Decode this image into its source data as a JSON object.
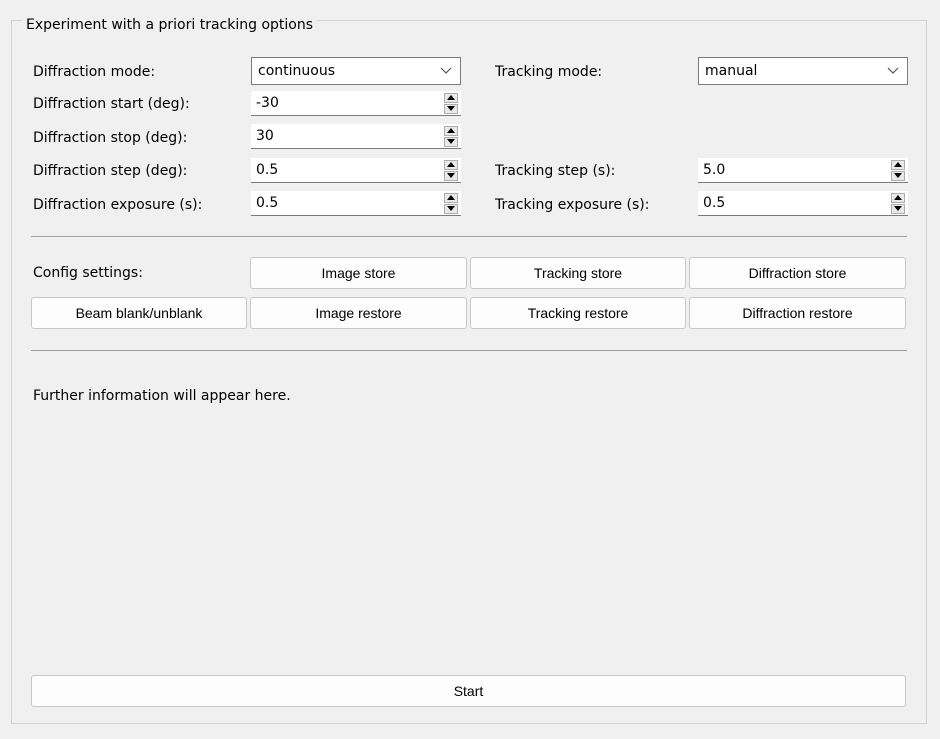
{
  "group": {
    "title": "Experiment with a priori tracking options"
  },
  "diffraction": {
    "mode_label": "Diffraction mode:",
    "mode_value": "continuous",
    "start_label": "Diffraction start (deg):",
    "start_value": "-30",
    "stop_label": "Diffraction stop (deg):",
    "stop_value": "30",
    "step_label": "Diffraction step (deg):",
    "step_value": "0.5",
    "exposure_label": "Diffraction exposure (s):",
    "exposure_value": "0.5"
  },
  "tracking": {
    "mode_label": "Tracking mode:",
    "mode_value": "manual",
    "step_label": "Tracking step (s):",
    "step_value": "5.0",
    "exposure_label": "Tracking exposure (s):",
    "exposure_value": "0.5"
  },
  "config": {
    "label": "Config settings:",
    "image_store": "Image store",
    "tracking_store": "Tracking store",
    "diffraction_store": "Diffraction store",
    "beam_blank": "Beam blank/unblank",
    "image_restore": "Image restore",
    "tracking_restore": "Tracking restore",
    "diffraction_restore": "Diffraction restore"
  },
  "info": {
    "message": "Further information will appear here."
  },
  "actions": {
    "start_label": "Start"
  },
  "icons": {
    "dropdown": "chevron-down-icon",
    "spin_up": "spin-up-arrow-icon",
    "spin_down": "spin-down-arrow-icon"
  }
}
